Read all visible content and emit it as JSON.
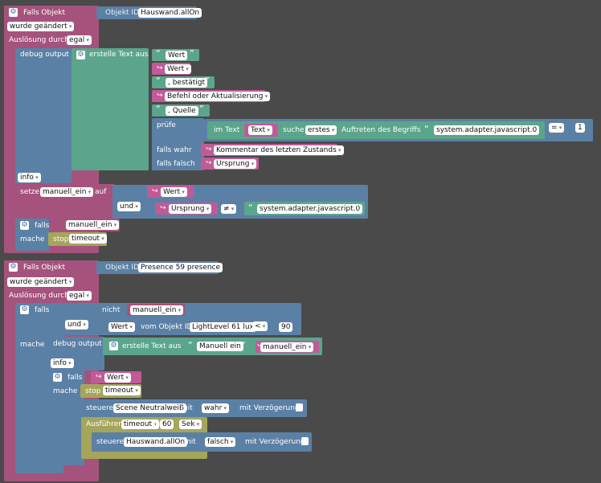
{
  "gear_glyph": "⚙",
  "arrow_glyph": "↪",
  "quote_open": "“",
  "quote_close": "”",
  "block1": {
    "title": "Falls Objekt",
    "objekt_id_label": "Objekt ID",
    "objekt_id_value": "Hauswand.allOn",
    "trigger_value": "wurde geändert",
    "ausloesung_label": "Auslösung durch",
    "ausloesung_value": "egal",
    "debug_label": "debug output",
    "erstelle_label": "erstelle Text aus",
    "text_wert": "Wert",
    "var_wert": "Wert",
    "text_bestaetigt": ", bestätigt",
    "var_befehl": "Befehl oder Aktualisierung",
    "text_quelle": ", Quelle",
    "pruefe_label": "prüfe",
    "im_text_label": "im Text",
    "var_text": "Text",
    "suche_label": "suche",
    "suche_value": "erstes",
    "auftreten_label": "Auftreten des Begriffs",
    "begriff_value": "system.adapter.javascript.0",
    "compare_op": "=",
    "compare_value": "1",
    "falls_wahr_label": "falls wahr",
    "falls_wahr_value": "Kommentar des letzten Zustands",
    "falls_falsch_label": "falls falsch",
    "falls_falsch_value": "Ursprung",
    "info_value": "info",
    "setze_label": "setze",
    "setze_var": "manuell_ein",
    "auf_label": "auf",
    "set_wert": "Wert",
    "und_value": "und",
    "ursprung_value": "Ursprung",
    "neq_op": "≠",
    "adapter_value": "system.adapter.javascript.0",
    "falls_label": "falls",
    "falls_var": "manuell_ein",
    "mache_label": "mache",
    "stop_label": "stop",
    "stop_value": "timeout"
  },
  "block2": {
    "title": "Falls Objekt",
    "objekt_id_label": "Objekt ID",
    "objekt_id_value": "Presence 59 presence",
    "trigger_value": "wurde geändert",
    "ausloesung_label": "Auslösung durch",
    "ausloesung_value": "egal",
    "falls_label": "falls",
    "nicht_label": "nicht",
    "nicht_var": "manuell_ein",
    "und_value": "und",
    "wert_value": "Wert",
    "vom_objekt_label": "vom Objekt ID",
    "vom_objekt_value": "LightLevel 61 lux",
    "lt_op": "<",
    "lt_value": "90",
    "mache_label": "mache",
    "debug_label": "debug output",
    "erstelle_label": "erstelle Text aus",
    "text_manuell": "Manuell ein",
    "var_manuell": "manuell_ein",
    "info_value": "info",
    "inner_falls_label": "falls",
    "inner_falls_var": "Wert",
    "inner_mache_label": "mache",
    "stop_label": "stop",
    "stop_value": "timeout",
    "steuere_label": "steuere",
    "steuere1_value": "Scene NeutralweiB",
    "mit_label": "mit",
    "steuere1_bool": "wahr",
    "verzoegerung_label": "mit Verzögerung",
    "ausfuehren_label": "Ausführen",
    "ausfuehren_var": "timeout",
    "in_label": "in",
    "in_value": "60",
    "sek_value": "Sek",
    "steuere2_value": "Hauswand.allOn",
    "steuere2_bool": "falsch"
  }
}
